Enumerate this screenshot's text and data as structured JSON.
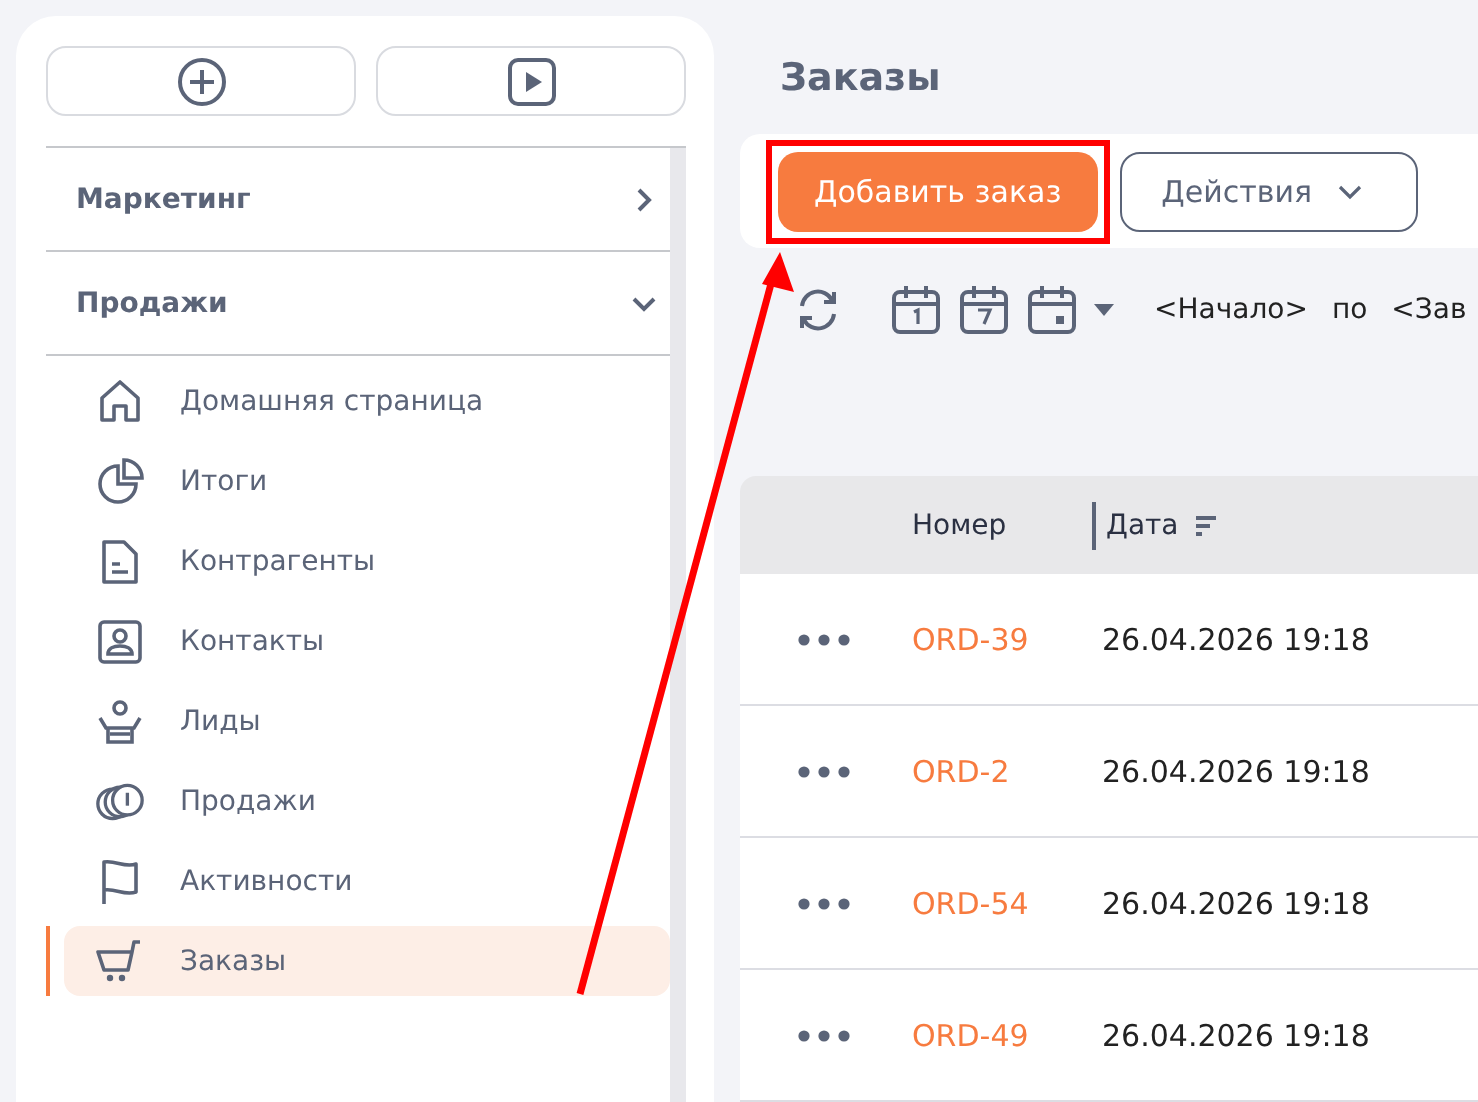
{
  "sidebar": {
    "sections": [
      {
        "label": "Маркетинг",
        "expanded": false
      },
      {
        "label": "Продажи",
        "expanded": true,
        "children": [
          {
            "label": "Домашняя страница",
            "selected": false
          },
          {
            "label": "Итоги",
            "selected": false
          },
          {
            "label": "Контрагенты",
            "selected": false
          },
          {
            "label": "Контакты",
            "selected": false
          },
          {
            "label": "Лиды",
            "selected": false
          },
          {
            "label": "Продажи",
            "selected": false
          },
          {
            "label": "Активности",
            "selected": false
          },
          {
            "label": "Заказы",
            "selected": true
          }
        ]
      }
    ]
  },
  "page": {
    "title": "Заказы"
  },
  "toolbar": {
    "add_button": {
      "label": "Добавить заказ",
      "highlighted": true
    },
    "actions_button": {
      "label": "Действия"
    }
  },
  "filter": {
    "start": "<Начало>",
    "separator": "по",
    "end": "<Зав"
  },
  "table": {
    "columns": [
      "Номер",
      "Дата"
    ],
    "rows": [
      {
        "number": "ORD-39",
        "date": "26.04.2026 19:18"
      },
      {
        "number": "ORD-2",
        "date": "26.04.2026 19:18"
      },
      {
        "number": "ORD-54",
        "date": "26.04.2026 19:18"
      },
      {
        "number": "ORD-49",
        "date": "26.04.2026 19:18"
      }
    ]
  }
}
